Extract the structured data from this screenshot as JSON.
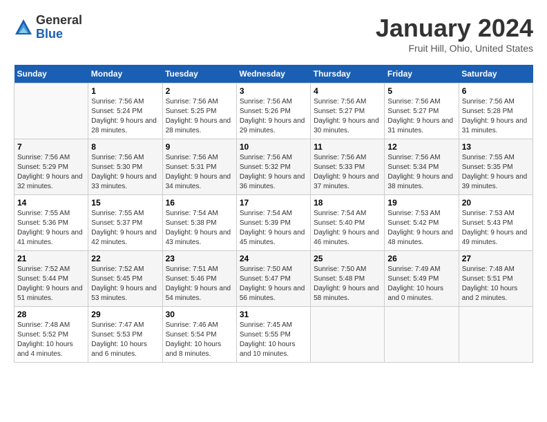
{
  "header": {
    "logo_general": "General",
    "logo_blue": "Blue",
    "title": "January 2024",
    "subtitle": "Fruit Hill, Ohio, United States"
  },
  "calendar": {
    "days_of_week": [
      "Sunday",
      "Monday",
      "Tuesday",
      "Wednesday",
      "Thursday",
      "Friday",
      "Saturday"
    ],
    "weeks": [
      [
        {
          "day": "",
          "sunrise": "",
          "sunset": "",
          "daylight": "",
          "empty": true
        },
        {
          "day": "1",
          "sunrise": "Sunrise: 7:56 AM",
          "sunset": "Sunset: 5:24 PM",
          "daylight": "Daylight: 9 hours and 28 minutes."
        },
        {
          "day": "2",
          "sunrise": "Sunrise: 7:56 AM",
          "sunset": "Sunset: 5:25 PM",
          "daylight": "Daylight: 9 hours and 28 minutes."
        },
        {
          "day": "3",
          "sunrise": "Sunrise: 7:56 AM",
          "sunset": "Sunset: 5:26 PM",
          "daylight": "Daylight: 9 hours and 29 minutes."
        },
        {
          "day": "4",
          "sunrise": "Sunrise: 7:56 AM",
          "sunset": "Sunset: 5:27 PM",
          "daylight": "Daylight: 9 hours and 30 minutes."
        },
        {
          "day": "5",
          "sunrise": "Sunrise: 7:56 AM",
          "sunset": "Sunset: 5:27 PM",
          "daylight": "Daylight: 9 hours and 31 minutes."
        },
        {
          "day": "6",
          "sunrise": "Sunrise: 7:56 AM",
          "sunset": "Sunset: 5:28 PM",
          "daylight": "Daylight: 9 hours and 31 minutes."
        }
      ],
      [
        {
          "day": "7",
          "sunrise": "Sunrise: 7:56 AM",
          "sunset": "Sunset: 5:29 PM",
          "daylight": "Daylight: 9 hours and 32 minutes."
        },
        {
          "day": "8",
          "sunrise": "Sunrise: 7:56 AM",
          "sunset": "Sunset: 5:30 PM",
          "daylight": "Daylight: 9 hours and 33 minutes."
        },
        {
          "day": "9",
          "sunrise": "Sunrise: 7:56 AM",
          "sunset": "Sunset: 5:31 PM",
          "daylight": "Daylight: 9 hours and 34 minutes."
        },
        {
          "day": "10",
          "sunrise": "Sunrise: 7:56 AM",
          "sunset": "Sunset: 5:32 PM",
          "daylight": "Daylight: 9 hours and 36 minutes."
        },
        {
          "day": "11",
          "sunrise": "Sunrise: 7:56 AM",
          "sunset": "Sunset: 5:33 PM",
          "daylight": "Daylight: 9 hours and 37 minutes."
        },
        {
          "day": "12",
          "sunrise": "Sunrise: 7:56 AM",
          "sunset": "Sunset: 5:34 PM",
          "daylight": "Daylight: 9 hours and 38 minutes."
        },
        {
          "day": "13",
          "sunrise": "Sunrise: 7:55 AM",
          "sunset": "Sunset: 5:35 PM",
          "daylight": "Daylight: 9 hours and 39 minutes."
        }
      ],
      [
        {
          "day": "14",
          "sunrise": "Sunrise: 7:55 AM",
          "sunset": "Sunset: 5:36 PM",
          "daylight": "Daylight: 9 hours and 41 minutes."
        },
        {
          "day": "15",
          "sunrise": "Sunrise: 7:55 AM",
          "sunset": "Sunset: 5:37 PM",
          "daylight": "Daylight: 9 hours and 42 minutes."
        },
        {
          "day": "16",
          "sunrise": "Sunrise: 7:54 AM",
          "sunset": "Sunset: 5:38 PM",
          "daylight": "Daylight: 9 hours and 43 minutes."
        },
        {
          "day": "17",
          "sunrise": "Sunrise: 7:54 AM",
          "sunset": "Sunset: 5:39 PM",
          "daylight": "Daylight: 9 hours and 45 minutes."
        },
        {
          "day": "18",
          "sunrise": "Sunrise: 7:54 AM",
          "sunset": "Sunset: 5:40 PM",
          "daylight": "Daylight: 9 hours and 46 minutes."
        },
        {
          "day": "19",
          "sunrise": "Sunrise: 7:53 AM",
          "sunset": "Sunset: 5:42 PM",
          "daylight": "Daylight: 9 hours and 48 minutes."
        },
        {
          "day": "20",
          "sunrise": "Sunrise: 7:53 AM",
          "sunset": "Sunset: 5:43 PM",
          "daylight": "Daylight: 9 hours and 49 minutes."
        }
      ],
      [
        {
          "day": "21",
          "sunrise": "Sunrise: 7:52 AM",
          "sunset": "Sunset: 5:44 PM",
          "daylight": "Daylight: 9 hours and 51 minutes."
        },
        {
          "day": "22",
          "sunrise": "Sunrise: 7:52 AM",
          "sunset": "Sunset: 5:45 PM",
          "daylight": "Daylight: 9 hours and 53 minutes."
        },
        {
          "day": "23",
          "sunrise": "Sunrise: 7:51 AM",
          "sunset": "Sunset: 5:46 PM",
          "daylight": "Daylight: 9 hours and 54 minutes."
        },
        {
          "day": "24",
          "sunrise": "Sunrise: 7:50 AM",
          "sunset": "Sunset: 5:47 PM",
          "daylight": "Daylight: 9 hours and 56 minutes."
        },
        {
          "day": "25",
          "sunrise": "Sunrise: 7:50 AM",
          "sunset": "Sunset: 5:48 PM",
          "daylight": "Daylight: 9 hours and 58 minutes."
        },
        {
          "day": "26",
          "sunrise": "Sunrise: 7:49 AM",
          "sunset": "Sunset: 5:49 PM",
          "daylight": "Daylight: 10 hours and 0 minutes."
        },
        {
          "day": "27",
          "sunrise": "Sunrise: 7:48 AM",
          "sunset": "Sunset: 5:51 PM",
          "daylight": "Daylight: 10 hours and 2 minutes."
        }
      ],
      [
        {
          "day": "28",
          "sunrise": "Sunrise: 7:48 AM",
          "sunset": "Sunset: 5:52 PM",
          "daylight": "Daylight: 10 hours and 4 minutes."
        },
        {
          "day": "29",
          "sunrise": "Sunrise: 7:47 AM",
          "sunset": "Sunset: 5:53 PM",
          "daylight": "Daylight: 10 hours and 6 minutes."
        },
        {
          "day": "30",
          "sunrise": "Sunrise: 7:46 AM",
          "sunset": "Sunset: 5:54 PM",
          "daylight": "Daylight: 10 hours and 8 minutes."
        },
        {
          "day": "31",
          "sunrise": "Sunrise: 7:45 AM",
          "sunset": "Sunset: 5:55 PM",
          "daylight": "Daylight: 10 hours and 10 minutes."
        },
        {
          "day": "",
          "sunrise": "",
          "sunset": "",
          "daylight": "",
          "empty": true
        },
        {
          "day": "",
          "sunrise": "",
          "sunset": "",
          "daylight": "",
          "empty": true
        },
        {
          "day": "",
          "sunrise": "",
          "sunset": "",
          "daylight": "",
          "empty": true
        }
      ]
    ]
  }
}
